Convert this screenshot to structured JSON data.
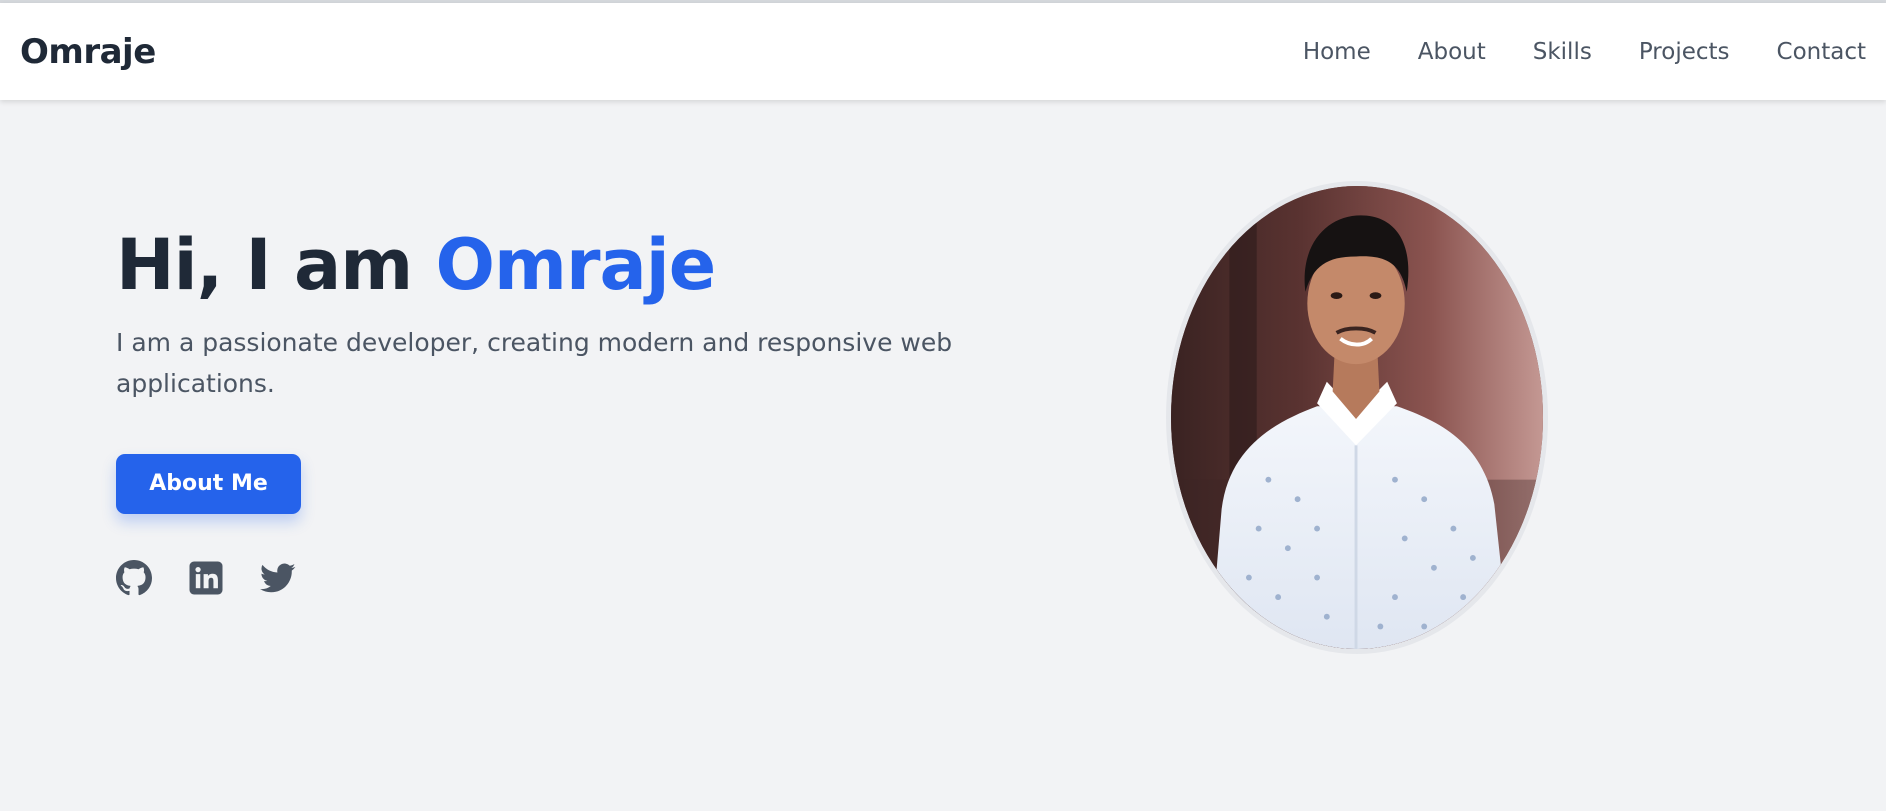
{
  "nav": {
    "brand": "Omraje",
    "links": [
      "Home",
      "About",
      "Skills",
      "Projects",
      "Contact"
    ]
  },
  "hero": {
    "greeting": "Hi, I am",
    "name": "Omraje",
    "description": "I am a passionate developer, creating modern and responsive web applications.",
    "cta_label": "About Me"
  },
  "social": {
    "icons": [
      "github-icon",
      "linkedin-icon",
      "twitter-icon"
    ]
  },
  "colors": {
    "accent": "#2563eb",
    "heading": "#1f2937",
    "text": "#4b5563",
    "background": "#f2f3f5",
    "navbar": "#ffffff"
  }
}
